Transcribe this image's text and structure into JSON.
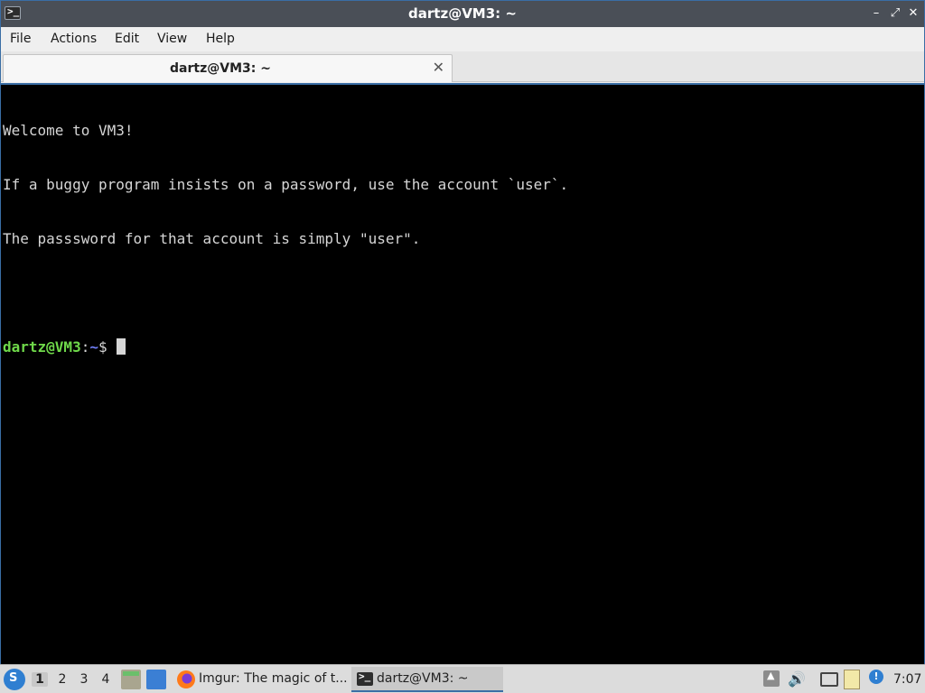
{
  "window": {
    "title": "dartz@VM3: ~",
    "app_icon": ">_",
    "min_glyph": "–",
    "restore_glyph": "⤢",
    "close_glyph": "✕"
  },
  "menu": {
    "items": [
      "File",
      "Actions",
      "Edit",
      "View",
      "Help"
    ]
  },
  "tab": {
    "label": "dartz@VM3: ~",
    "close_glyph": "✕"
  },
  "terminal": {
    "lines": [
      "Welcome to VM3!",
      "If a buggy program insists on a password, use the account `user`.",
      "The passsword for that account is simply \"user\"."
    ],
    "prompt": {
      "user_host": "dartz@VM3",
      "colon": ":",
      "path": "~",
      "dollar": "$"
    },
    "colors": {
      "background": "#000000",
      "text": "#d6d6d6",
      "user_host": "#6fd94a",
      "path": "#6f7df5"
    }
  },
  "taskbar": {
    "workspaces": [
      "1",
      "2",
      "3",
      "4"
    ],
    "active_workspace": "1",
    "tasks": [
      {
        "label": "Imgur: The magic of t...",
        "icon": "firefox-icon"
      },
      {
        "label": "dartz@VM3: ~",
        "icon": "terminal-icon"
      }
    ],
    "clock": "7:07",
    "tray_up_glyph": "▲",
    "volume_glyph": "🔊",
    "notify_glyph": "!"
  },
  "colors": {
    "accent": "#3a6ea5",
    "titlebar": "#4a4f57",
    "taskbar": "#dcdcdc"
  }
}
